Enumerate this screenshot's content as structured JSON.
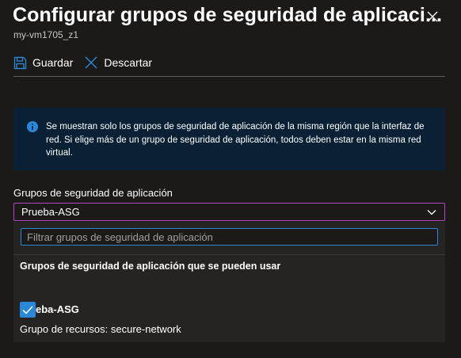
{
  "panel": {
    "title": "Configurar grupos de seguridad de aplicaci...",
    "subtitle": "my-vm1705_z1"
  },
  "toolbar": {
    "save_label": "Guardar",
    "discard_label": "Descartar"
  },
  "info": {
    "text": "Se muestran solo los grupos de seguridad de aplicación de la misma región que la interfaz de red. Si elige más de un grupo de seguridad de aplicación, todos deben estar en la misma red virtual."
  },
  "asg_field": {
    "label": "Grupos de seguridad de aplicación",
    "selected_value": "Prueba-ASG"
  },
  "dropdown": {
    "filter_placeholder": "Filtrar grupos de seguridad de aplicación",
    "group_header": "Grupos de seguridad de aplicación que se pueden usar",
    "options": [
      {
        "name": "eba-ASG",
        "resource_group": "Grupo de recursos: secure-network",
        "checked": true
      }
    ]
  },
  "colors": {
    "background": "#1b1a19",
    "accent": "#2b88d8",
    "info_background": "#092035",
    "focus_border": "#b146c2"
  },
  "icons": [
    "close-icon",
    "save-icon",
    "discard-icon",
    "info-icon",
    "chevron-down-icon",
    "checkmark-icon"
  ]
}
